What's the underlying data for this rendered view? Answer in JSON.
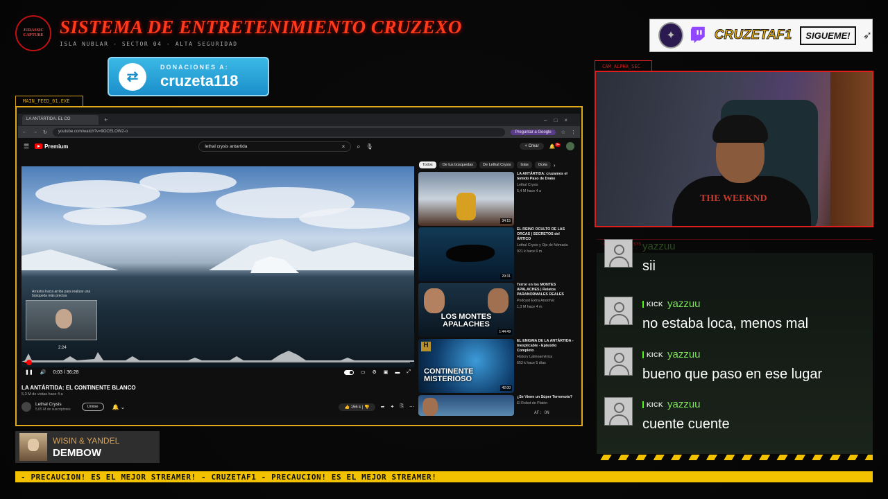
{
  "header": {
    "logo_text": "JURASSIC CAPTURE",
    "title": "SISTEMA DE ENTRETENIMIENTO CRUZEXO",
    "subtitle": "ISLA NUBLAR - SECTOR 04 - ALTA SEGURIDAD"
  },
  "donation": {
    "label": "DONACIONES A:",
    "user": "cruzeta118"
  },
  "twitch": {
    "name": "CRUZETAF1",
    "follow": "SIGUEME!"
  },
  "feed": {
    "tab_label": "MAIN_FEED_01.EXE"
  },
  "browser": {
    "tab_title": "LA ANTÁRTIDA: EL CO",
    "url": "youtube.com/watch?v=9OCELOW2-o",
    "gemini": "Preguntar a Google"
  },
  "youtube": {
    "brand": "Premium",
    "search_query": "lethal crysis antartida",
    "create_label": "Crear",
    "notif_count": "9+",
    "hint": "Arrastra hacia arriba para realizar una búsqueda más precisa",
    "time_tooltip": "2:24",
    "time_display": "0:03 / 36:28",
    "progress": 0.0014,
    "video_title": "LA ANTÁRTIDA: EL CONTINENTE BLANCO",
    "video_meta": "5,3 M de vistas  hace 4 a",
    "channel_name": "Lethal Crysis",
    "channel_subs": "5,05 M de suscriptores",
    "join_label": "Unirse",
    "likes": "156 k",
    "chips": [
      "Todos",
      "De tus búsquedas",
      "De Lethal Crysis",
      "Islas",
      "Océa"
    ],
    "recommendations": [
      {
        "title": "LA ANTÁRTIDA: cruzamos el temido Paso de Drake",
        "channel": "Lethal Crysis",
        "meta": "5,4 M  hace 4 a",
        "duration": "34:15",
        "thumb_text": ""
      },
      {
        "title": "EL REINO OCULTO DE LAS ORCAS | SECRETOS del ÁRTICO",
        "channel": "Lethal Crysis y Ojo de Nómada",
        "meta": "921 k  hace 6 m",
        "duration": "29:31",
        "thumb_text": ""
      },
      {
        "title": "Terror en los MONTES APALACHES | Relatos PARANORMALES REALES",
        "channel": "Podcast Extra Anormal",
        "meta": "1,3 M  hace 4 m",
        "duration": "1:44:49",
        "thumb_text": "LOS MONTES APALACHES"
      },
      {
        "title": "EL ENIGMA DE LA ANTÁRTIDA - Inexplicable - Episodio Completo",
        "channel": "History Latinoamérica",
        "meta": "653 k  hace 5 días",
        "duration": "42:00",
        "thumb_text": "CONTINENTE MISTERIOSO"
      },
      {
        "title": "¿Se Viene un Súper Terremoto?",
        "channel": "El Robot de Platón",
        "meta": "",
        "duration": "",
        "thumb_text": ""
      }
    ],
    "af_status": "AF: ON"
  },
  "music": {
    "artist": "WISIN & YANDEL",
    "song": "DEMBOW"
  },
  "cam": {
    "tab_label": "CAM_ALPHA_SEC",
    "shirt_text": "THE WEEKND"
  },
  "chat": {
    "tab_label": "CHAT_LOG_V2.SYS",
    "messages": [
      {
        "platform": "",
        "user": "yazzuu",
        "text": "sii"
      },
      {
        "platform": "KICK",
        "user": "yazzuu",
        "text": "no estaba loca, menos mal"
      },
      {
        "platform": "KICK",
        "user": "yazzuu",
        "text": "bueno que paso en ese lugar"
      },
      {
        "platform": "KICK",
        "user": "yazzuu",
        "text": "cuente cuente"
      }
    ]
  },
  "ticker": {
    "text": "- PRECAUCION! ES EL MEJOR STREAMER! - CRUZETAF1 - PRECAUCION! ES EL MEJOR STREAMER!"
  },
  "colors": {
    "accent_red": "#e01c1c",
    "accent_yellow": "#f2c200",
    "kick_green": "#53fc18"
  }
}
